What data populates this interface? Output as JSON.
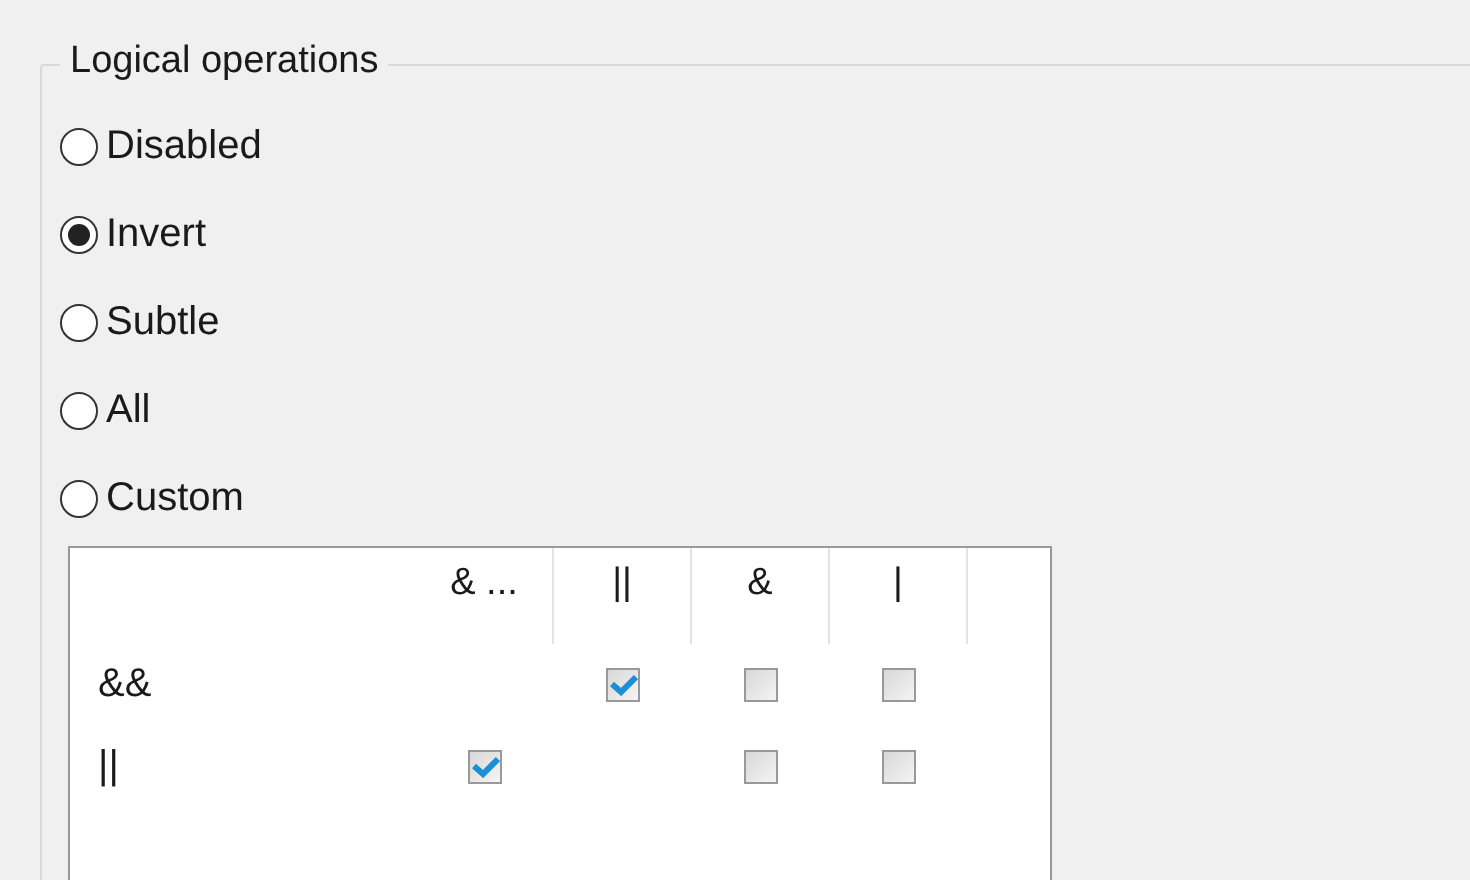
{
  "group": {
    "title": "Logical operations"
  },
  "options": [
    {
      "label": "Disabled",
      "selected": false
    },
    {
      "label": "Invert",
      "selected": true
    },
    {
      "label": "Subtle",
      "selected": false
    },
    {
      "label": "All",
      "selected": false
    },
    {
      "label": "Custom",
      "selected": false
    }
  ],
  "table": {
    "columns": [
      "& ...",
      "||",
      "&",
      "|"
    ],
    "rows": [
      {
        "label": "&&",
        "cells": [
          {
            "kind": "empty"
          },
          {
            "kind": "checkbox",
            "checked": true
          },
          {
            "kind": "checkbox",
            "checked": false
          },
          {
            "kind": "checkbox",
            "checked": false
          }
        ]
      },
      {
        "label": "||",
        "cells": [
          {
            "kind": "checkbox",
            "checked": true
          },
          {
            "kind": "empty"
          },
          {
            "kind": "checkbox",
            "checked": false
          },
          {
            "kind": "checkbox",
            "checked": false
          }
        ]
      }
    ]
  }
}
